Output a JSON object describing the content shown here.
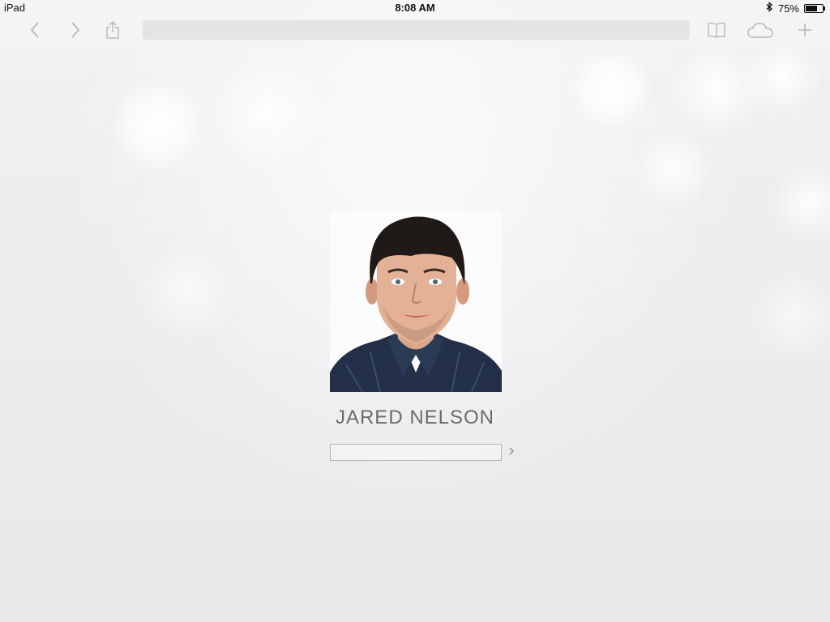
{
  "status_bar": {
    "device": "iPad",
    "time": "8:08 AM",
    "battery": "75%",
    "battery_level": 0.75
  },
  "toolbar": {
    "icons": [
      "back-icon",
      "forward-icon",
      "share-icon",
      "bookmarks-icon",
      "icloud-tabs-icon",
      "new-tab-icon"
    ],
    "address": ""
  },
  "profile": {
    "name": "JARED NELSON",
    "password_value": "",
    "submit_icon": "chevron-right-icon"
  }
}
